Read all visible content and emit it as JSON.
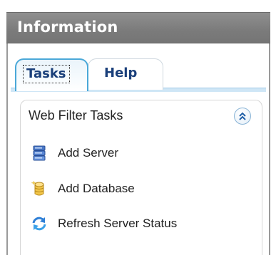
{
  "window": {
    "title": "Information"
  },
  "tabs": [
    {
      "label": "Tasks",
      "selected": true
    },
    {
      "label": "Help",
      "selected": false
    }
  ],
  "tasks_panel": {
    "heading": "Web Filter Tasks",
    "collapse_icon": "double-chevron-up-icon",
    "items": [
      {
        "label": "Add Server",
        "icon": "server-icon"
      },
      {
        "label": "Add Database",
        "icon": "database-icon"
      },
      {
        "label": "Refresh Server Status",
        "icon": "refresh-icon"
      }
    ]
  },
  "colors": {
    "title_bar": "#7e7e7e",
    "title_text": "#ffffff",
    "tab_accent": "#4aa8d8",
    "tab_text": "#1a3f7a"
  }
}
